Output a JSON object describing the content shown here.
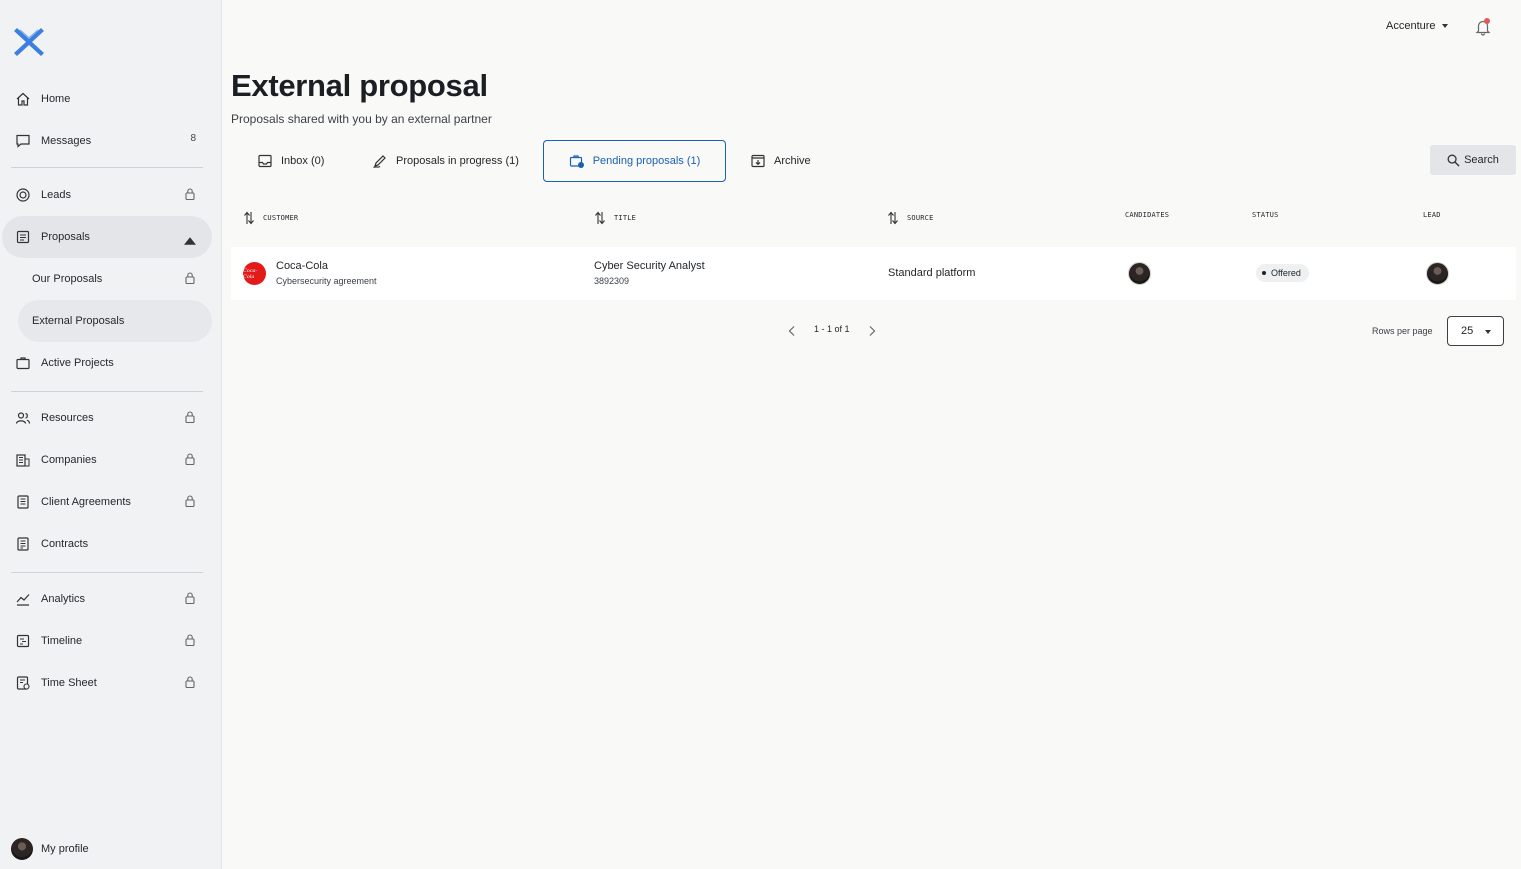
{
  "topbar": {
    "company": "Accenture"
  },
  "sidebar": {
    "home": "Home",
    "messages": {
      "label": "Messages",
      "count": "8"
    },
    "leads": "Leads",
    "proposals": "Proposals",
    "our_proposals": "Our Proposals",
    "external_proposals": "External Proposals",
    "active_projects": "Active Projects",
    "resources": "Resources",
    "companies": "Companies",
    "client_agreements": "Client Agreements",
    "contracts": "Contracts",
    "analytics": "Analytics",
    "timeline": "Timeline",
    "time_sheet": "Time Sheet",
    "profile": "My profile"
  },
  "page": {
    "title": "External proposal",
    "subtitle": "Proposals shared with you by an external partner"
  },
  "tabs": {
    "inbox": "Inbox (0)",
    "in_progress": "Proposals in progress (1)",
    "pending": "Pending proposals (1)",
    "archive": "Archive"
  },
  "search": {
    "label": "Search"
  },
  "table": {
    "headers": {
      "customer": "Customer",
      "title": "Title",
      "source": "Source",
      "candidates": "Candidates",
      "status": "Status",
      "lead": "Lead"
    },
    "rows": [
      {
        "customer": "Coca-Cola",
        "customer_sub": "Cybersecurity agreement",
        "title": "Cyber Security Analyst",
        "title_sub": "3892309",
        "source": "Standard platform",
        "status": "Offered"
      }
    ]
  },
  "pagination": {
    "range": "1 - 1 of 1",
    "rows_per_page_label": "Rows per page",
    "rows_per_page": "25"
  },
  "colors": {
    "accent": "#1a5fb4",
    "logo": "#3d7fe0",
    "coca_cola": "#e21a1a",
    "notification": "#e05a5a"
  }
}
